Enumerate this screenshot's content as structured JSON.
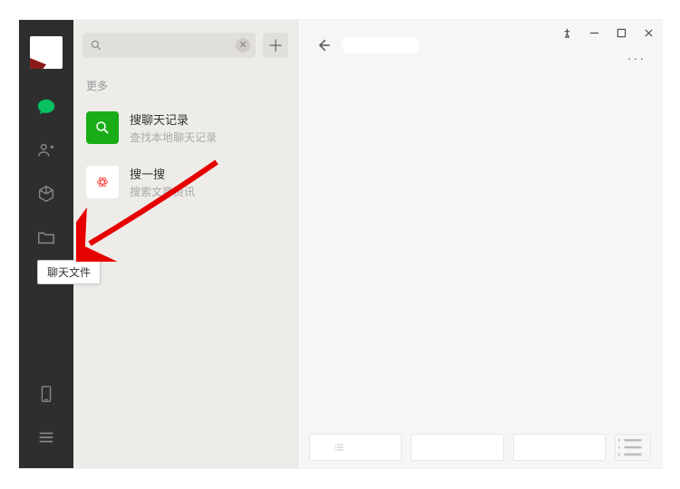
{
  "sidebar": {
    "tooltip": "聊天文件"
  },
  "list": {
    "section_label": "更多",
    "items": [
      {
        "title": "搜聊天记录",
        "sub": "查找本地聊天记录"
      },
      {
        "title": "搜一搜",
        "sub": "搜索文章资讯"
      }
    ]
  },
  "content": {
    "more_label": "···"
  }
}
